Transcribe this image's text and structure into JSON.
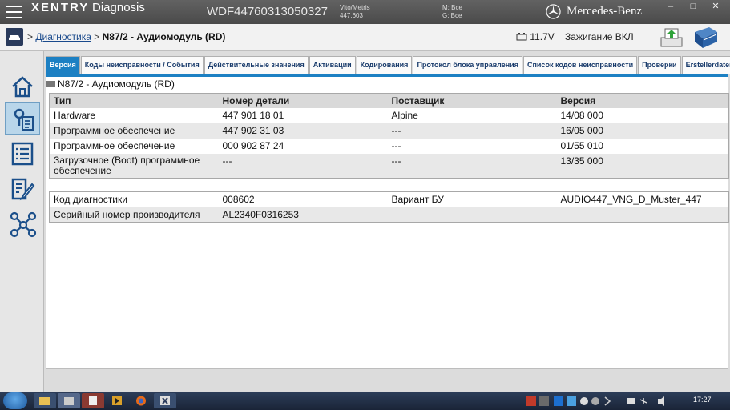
{
  "titlebar": {
    "brand": "XENTRY",
    "product": "Diagnosis",
    "vin": "WDF44760313050327",
    "model_line1": "Vito/Metris",
    "model_line2": "447.603",
    "m_line": "M: Все",
    "g_line": "G: Все",
    "maker": "Mercedes-Benz"
  },
  "header": {
    "breadcrumb_parent": "Диагностика",
    "breadcrumb_sep": ">",
    "breadcrumb_current": "N87/2 - Аудиомодуль (RD)",
    "battery_voltage": "11.7V",
    "ignition": "Зажигание ВКЛ"
  },
  "sidebar": {
    "items": [
      {
        "name": "home",
        "active": false
      },
      {
        "name": "diagnosis",
        "active": true
      },
      {
        "name": "list",
        "active": false
      },
      {
        "name": "edit",
        "active": false
      },
      {
        "name": "network",
        "active": false
      }
    ]
  },
  "tabs": [
    {
      "label": "Версия",
      "active": true
    },
    {
      "label": "Коды неисправности / События",
      "active": false
    },
    {
      "label": "Действительные значения",
      "active": false
    },
    {
      "label": "Активации",
      "active": false
    },
    {
      "label": "Кодирования",
      "active": false
    },
    {
      "label": "Протокол блока управления",
      "active": false
    },
    {
      "label": "Список кодов неисправности",
      "active": false
    },
    {
      "label": "Проверки",
      "active": false
    },
    {
      "label": "Erstellerdaten",
      "active": false
    }
  ],
  "content": {
    "title": "N87/2 - Аудиомодуль (RD)",
    "version_table": {
      "headers": [
        "Тип",
        "Номер детали",
        "Поставщик",
        "Версия"
      ],
      "rows": [
        [
          "Hardware",
          "447 901 18 01",
          "Alpine",
          "14/08 000"
        ],
        [
          "Программное обеспечение",
          "447 902 31 03",
          "---",
          "16/05 000"
        ],
        [
          "Программное обеспечение",
          "000 902 87 24",
          "---",
          "01/55 010"
        ],
        [
          "Загрузочное (Boot) программное обеспечение",
          "---",
          "---",
          "13/35 000"
        ]
      ]
    },
    "info_table": {
      "rows": [
        [
          "Код диагностики",
          "008602",
          "Вариант БУ",
          "AUDIO447_VNG_D_Muster_447"
        ],
        [
          "Серийный номер производителя",
          "AL2340F0316253",
          "",
          ""
        ]
      ]
    }
  },
  "taskbar": {
    "clock": "17:27"
  }
}
